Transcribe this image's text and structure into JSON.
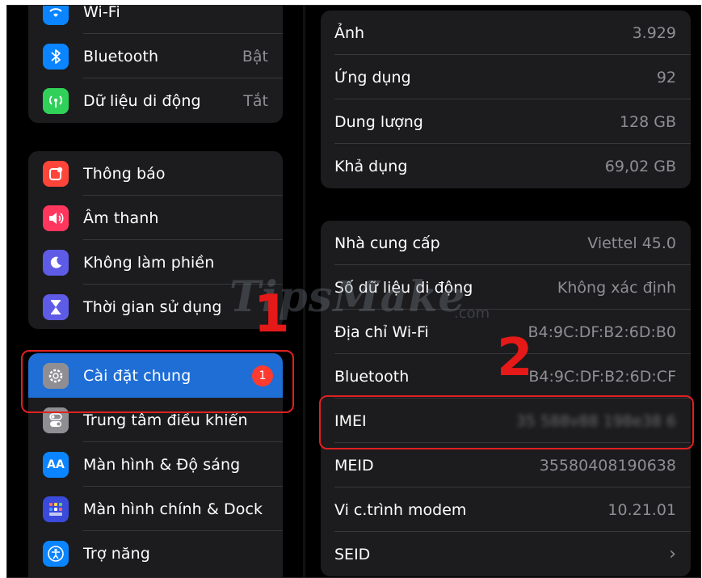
{
  "left": {
    "group_top": [
      {
        "name": "wifi",
        "label": "Wi-Fi",
        "value": "",
        "icon": "wifi-icon",
        "color": "#0a84ff"
      },
      {
        "name": "bluetooth",
        "label": "Bluetooth",
        "value": "Bật",
        "icon": "bluetooth-icon",
        "color": "#0a84ff"
      },
      {
        "name": "cellular",
        "label": "Dữ liệu di động",
        "value": "Tắt",
        "icon": "cellular-icon",
        "color": "#30d158"
      }
    ],
    "group_notifications": [
      {
        "name": "notifications",
        "label": "Thông báo",
        "icon": "notifications-icon",
        "color": "#ff453a"
      },
      {
        "name": "sounds",
        "label": "Âm thanh",
        "icon": "sound-icon",
        "color": "#ff375f"
      },
      {
        "name": "do-not-disturb",
        "label": "Không làm phiền",
        "icon": "moon-icon",
        "color": "#5e5ce6"
      },
      {
        "name": "screen-time",
        "label": "Thời gian sử dụng",
        "icon": "hourglass-icon",
        "color": "#5e5ce6"
      }
    ],
    "group_general": [
      {
        "name": "general",
        "label": "Cài đặt chung",
        "badge": "1",
        "icon": "gear-icon",
        "color": "#8e8e93"
      },
      {
        "name": "control-center",
        "label": "Trung tâm điều khiển",
        "icon": "toggles-icon",
        "color": "#8e8e93"
      },
      {
        "name": "display",
        "label": "Màn hình & Độ sáng",
        "icon": "text-size-icon",
        "color": "#0a84ff"
      },
      {
        "name": "home-screen",
        "label": "Màn hình chính & Dock",
        "icon": "grid-icon",
        "color": "#3a4bdb"
      },
      {
        "name": "accessibility",
        "label": "Trợ năng",
        "icon": "accessibility-icon",
        "color": "#0a84ff"
      }
    ]
  },
  "right": {
    "group_storage": [
      {
        "name": "photos",
        "label": "Ảnh",
        "value": "3.929"
      },
      {
        "name": "apps",
        "label": "Ứng dụng",
        "value": "92"
      },
      {
        "name": "capacity",
        "label": "Dung lượng",
        "value": "128 GB"
      },
      {
        "name": "available",
        "label": "Khả dụng",
        "value": "69,02 GB"
      }
    ],
    "group_network": [
      {
        "name": "carrier",
        "label": "Nhà cung cấp",
        "value": "Viettel 45.0"
      },
      {
        "name": "mobile-number",
        "label": "Số dữ liệu di động",
        "value": "Không xác định"
      },
      {
        "name": "wifi-address",
        "label": "Địa chỉ Wi-Fi",
        "value": "B4:9C:DF:B2:6D:B0"
      },
      {
        "name": "bluetooth-address",
        "label": "Bluetooth",
        "value": "B4:9C:DF:B2:6D:CF"
      },
      {
        "name": "imei",
        "label": "IMEI",
        "value": "35 588v88 198e38 6",
        "blurred": true
      },
      {
        "name": "meid",
        "label": "MEID",
        "value": "35580408190638"
      },
      {
        "name": "modem-firmware",
        "label": "Vi c.trình modem",
        "value": "10.21.01"
      },
      {
        "name": "seid",
        "label": "SEID",
        "value": "›"
      }
    ]
  },
  "annotations": {
    "step1": "1",
    "step2": "2",
    "watermark": "TipsMake",
    "watermark_suffix": ".com",
    "highlight_color": "#e02020"
  }
}
